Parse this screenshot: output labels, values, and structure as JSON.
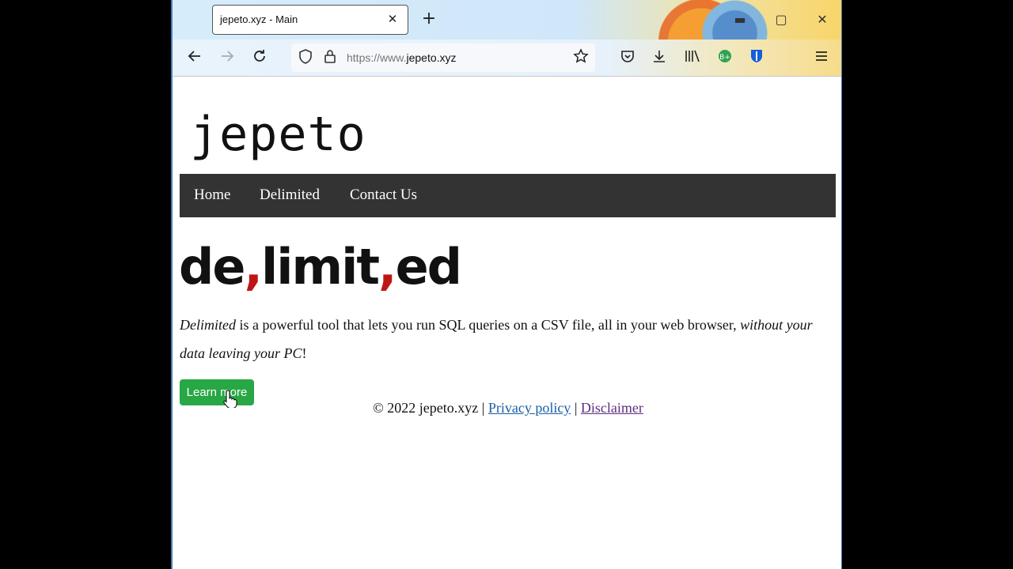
{
  "browser": {
    "tab_title": "jepeto.xyz - Main",
    "url_prefix": "https://www.",
    "url_host": "jepeto.xyz"
  },
  "site": {
    "logo_text": "jepeto",
    "nav": [
      "Home",
      "Delimited",
      "Contact Us"
    ],
    "product_logo": {
      "part1": "de",
      "comma": ",",
      "part2": "limit",
      "part3": "ed"
    },
    "description": {
      "lead": "Delimited",
      "middle": " is a powerful tool that lets you run SQL queries on a CSV file, all in your web browser, ",
      "emph": "without your data leaving your PC",
      "tail": "!"
    },
    "learn_more": "Learn more",
    "footer": {
      "copyright": "© 2022 jepeto.xyz | ",
      "privacy": "Privacy policy",
      "sep": " | ",
      "disclaimer": "Disclaimer"
    }
  },
  "icons": [
    "back-icon",
    "forward-icon",
    "reload-icon",
    "shield-icon",
    "lock-icon",
    "star-icon",
    "pocket-icon",
    "download-icon",
    "library-icon",
    "extension-icon",
    "bitwarden-icon",
    "menu-icon"
  ]
}
